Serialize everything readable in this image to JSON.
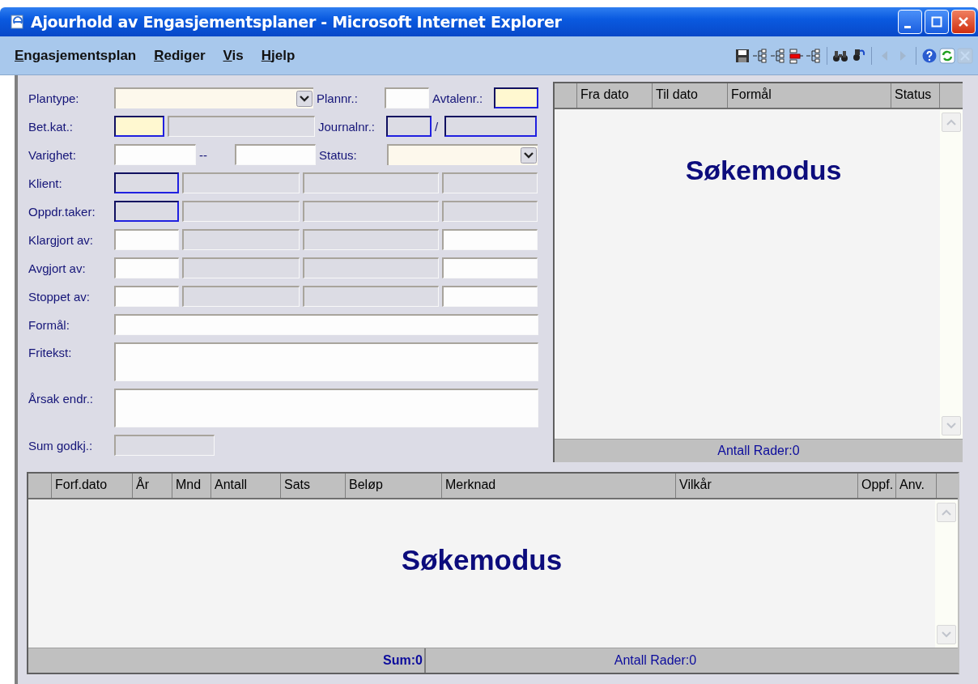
{
  "window": {
    "title": "Ajourhold av Engasjementsplaner - Microsoft Internet Explorer"
  },
  "menu": [
    {
      "label": "Engasjementsplan"
    },
    {
      "label": "Rediger"
    },
    {
      "label": "Vis"
    },
    {
      "label": "Hjelp"
    }
  ],
  "toolbar": [
    {
      "items": [
        {
          "kind": "save",
          "disabled": false
        },
        {
          "kind": "tree-in",
          "disabled": false
        },
        {
          "kind": "tree-out",
          "disabled": false
        },
        {
          "kind": "tree-red",
          "disabled": false
        },
        {
          "kind": "tree-right",
          "disabled": false
        }
      ]
    },
    {
      "items": [
        {
          "kind": "binoculars",
          "disabled": false
        },
        {
          "kind": "find-user",
          "disabled": false
        }
      ]
    },
    {
      "items": [
        {
          "kind": "back",
          "disabled": true
        },
        {
          "kind": "forward",
          "disabled": true
        }
      ]
    },
    {
      "items": [
        {
          "kind": "help",
          "disabled": false
        },
        {
          "kind": "refresh",
          "disabled": false
        },
        {
          "kind": "close",
          "disabled": true
        }
      ]
    }
  ],
  "form": {
    "rows": [
      {
        "items": [
          {
            "kind": "label",
            "text": "Plantype:"
          },
          {
            "kind": "select",
            "required": false,
            "readonly": false
          },
          {
            "kind": "label",
            "text": "Plannr.:"
          },
          {
            "kind": "field",
            "required": false,
            "readonly": false
          },
          {
            "kind": "label",
            "text": "Avtalenr.:"
          },
          {
            "kind": "field",
            "required": true,
            "readonly": false
          }
        ]
      },
      {
        "items": [
          {
            "kind": "label",
            "text": "Bet.kat.:"
          },
          {
            "kind": "field",
            "required": true,
            "readonly": false
          },
          {
            "kind": "field",
            "required": false,
            "readonly": true
          },
          {
            "kind": "label",
            "text": "Journalnr.:"
          },
          {
            "kind": "field",
            "required": true,
            "readonly": true
          },
          {
            "kind": "label",
            "text": "/"
          },
          {
            "kind": "field",
            "required": true,
            "readonly": true
          }
        ]
      },
      {
        "items": [
          {
            "kind": "label",
            "text": "Varighet:"
          },
          {
            "kind": "field",
            "required": false,
            "readonly": false
          },
          {
            "kind": "label",
            "text": "--"
          },
          {
            "kind": "field",
            "required": false,
            "readonly": false
          },
          {
            "kind": "label",
            "text": "Status:"
          },
          {
            "kind": "select",
            "required": false,
            "readonly": false
          }
        ]
      },
      {
        "items": [
          {
            "kind": "label",
            "text": "Klient:"
          },
          {
            "kind": "field",
            "required": true,
            "readonly": true
          },
          {
            "kind": "field",
            "required": false,
            "readonly": true
          },
          {
            "kind": "field",
            "required": false,
            "readonly": true
          },
          {
            "kind": "field",
            "required": false,
            "readonly": true
          }
        ]
      },
      {
        "items": [
          {
            "kind": "label",
            "text": "Oppdr.taker:"
          },
          {
            "kind": "field",
            "required": true,
            "readonly": true
          },
          {
            "kind": "field",
            "required": false,
            "readonly": true
          },
          {
            "kind": "field",
            "required": false,
            "readonly": true
          },
          {
            "kind": "field",
            "required": false,
            "readonly": true
          }
        ]
      },
      {
        "items": [
          {
            "kind": "label",
            "text": "Klargjort av:"
          },
          {
            "kind": "field",
            "required": false,
            "readonly": false
          },
          {
            "kind": "field",
            "required": false,
            "readonly": true
          },
          {
            "kind": "field",
            "required": false,
            "readonly": true
          },
          {
            "kind": "field",
            "required": false,
            "readonly": false
          }
        ]
      },
      {
        "items": [
          {
            "kind": "label",
            "text": "Avgjort av:"
          },
          {
            "kind": "field",
            "required": false,
            "readonly": false
          },
          {
            "kind": "field",
            "required": false,
            "readonly": true
          },
          {
            "kind": "field",
            "required": false,
            "readonly": true
          },
          {
            "kind": "field",
            "required": false,
            "readonly": false
          }
        ]
      },
      {
        "items": [
          {
            "kind": "label",
            "text": "Stoppet av:"
          },
          {
            "kind": "field",
            "required": false,
            "readonly": false
          },
          {
            "kind": "field",
            "required": false,
            "readonly": true
          },
          {
            "kind": "field",
            "required": false,
            "readonly": true
          },
          {
            "kind": "field",
            "required": false,
            "readonly": false
          }
        ]
      },
      {
        "items": [
          {
            "kind": "label",
            "text": "Formål:"
          },
          {
            "kind": "field",
            "required": false,
            "readonly": false
          }
        ]
      },
      {
        "items": [
          {
            "kind": "label",
            "text": "Fritekst:"
          },
          {
            "kind": "textarea",
            "required": false,
            "readonly": false
          }
        ]
      },
      {
        "items": [
          {
            "kind": "label",
            "text": "Årsak endr.:"
          },
          {
            "kind": "textarea",
            "required": false,
            "readonly": false
          }
        ]
      },
      {
        "items": [
          {
            "kind": "label",
            "text": "Sum godkj.:"
          },
          {
            "kind": "field",
            "required": false,
            "readonly": true
          }
        ]
      }
    ]
  },
  "plan_grid": {
    "columns": [
      "Fra dato",
      "Til dato",
      "Formål",
      "Status"
    ],
    "mode": "Søkemodus",
    "footer": "Antall Rader:0"
  },
  "payment_grid": {
    "columns": [
      "Forf.dato",
      "År",
      "Mnd",
      "Antall",
      "Sats",
      "Beløp",
      "Merknad",
      "Vilkår",
      "Oppf.",
      "Anv."
    ],
    "mode": "Søkemodus",
    "sum": "Sum:0",
    "footer": "Antall Rader:0"
  }
}
